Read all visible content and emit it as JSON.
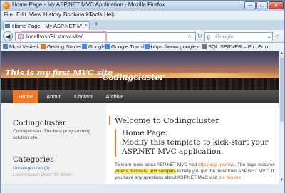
{
  "window": {
    "title": "Home Page - My ASP.NET MVC Application - Mozilla Firefox",
    "minimize": "–",
    "maximize": "□",
    "close": "✕"
  },
  "menu": [
    "File",
    "Edit",
    "View",
    "History",
    "Bookmarks",
    "Tools",
    "Help"
  ],
  "tab": {
    "title": "Home Page - My ASP.NET MVC Applica...",
    "close": "×",
    "new_tab": "+"
  },
  "nav": {
    "url": "localhost/Firstmvcsite/",
    "search_placeholder": "Google",
    "search_engine_icon": "google-g-icon"
  },
  "bookmarks": [
    {
      "label": "Most Visited",
      "icon_color": "#5a7fb8"
    },
    {
      "label": "Getting Started",
      "icon_color": "#e07b1f"
    },
    {
      "label": "Google",
      "icon_color": "#4285f4"
    },
    {
      "label": "Google Translate",
      "icon_color": "#4285f4"
    },
    {
      "label": "https://www.google.c...",
      "icon_color": "#4285f4"
    },
    {
      "label": "SQL SERVER – Fix: Erro...",
      "icon_color": "#777777"
    }
  ],
  "site": {
    "title": "This is my first MVC site",
    "subtitle": "-Codingcluster",
    "nav": [
      {
        "label": "Home",
        "active": true
      },
      {
        "label": "About",
        "active": false
      },
      {
        "label": "Contact",
        "active": false
      },
      {
        "label": "Archive",
        "active": false
      }
    ],
    "accent": "#f07a2a"
  },
  "sidebar": {
    "blog_heading": "Codingcluster",
    "blog_desc": "Codingcluster -The best programming",
    "blog_desc2": "solution site.",
    "categories_heading": "Categories",
    "category_1": "Uncategorized (3)",
    "category_2": "Lorem Ipsum Dolor Sit Amet"
  },
  "main": {
    "welcome": "Welcome to Codingcluster",
    "page_heading": "Home Page.",
    "page_text": "Modify this template to kick-start your ASP.NET MVC application.",
    "body_pre": "To learn more about ASP.NET MVC visit ",
    "body_link": "http://asp.net/mvc",
    "body_mid": ". The page features ",
    "body_highlight": "videos, tutorials, and samples",
    "body_post": " to help you get the most from ASP.NET MVC. If you have any questions about ASP.NET MVC visit",
    "body_link2": "our forums"
  }
}
